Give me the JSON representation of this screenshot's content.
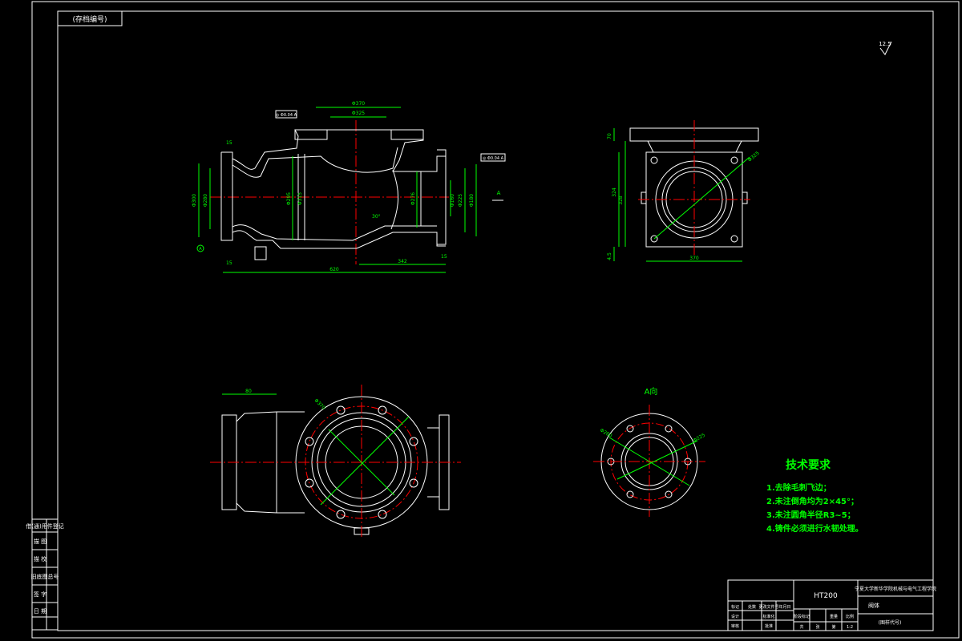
{
  "drawing": {
    "top_left_tag": "(存档编号)",
    "roughness_mark": "12.5",
    "material": "HT200",
    "view_label": "A向",
    "section_label": "A"
  },
  "dimensions": {
    "flange_outer": "Φ370",
    "flange_bolt": "Φ325",
    "left_flange_height": "15",
    "pipe_main": "Φ295",
    "pipe_inner": "Φ315",
    "pipe_side": "Φ276",
    "right_flange_thk": "15",
    "total_length": "620",
    "right_length": "342",
    "bottom_len": "15",
    "left_phi": "Φ300",
    "left_phi2": "Φ280",
    "right_phi": "Φ225",
    "right_phi2": "Φ180",
    "right_phi3": "Φ160",
    "top_height": "70",
    "side_height": "324",
    "side_inner": "328",
    "side_width": "370",
    "side_small": "4.5",
    "side_diag": "Φ325",
    "front_len": "80",
    "front_diag": "Φ370",
    "av_diag1": "Φ260",
    "av_diag2": "Φ225",
    "angle": "30°",
    "tol_box1": "◎ Φ0.04 A",
    "tol_box2": "◎ Φ0.04 A"
  },
  "tech": {
    "title": "技术要求",
    "items": [
      "1.去除毛刺飞边；",
      "2.未注倒角均为2×45°；",
      "3.未注圆角半径R3~5；",
      "4.铸件必须进行水韧处理。"
    ]
  },
  "left_strip": {
    "labels": [
      "借(通)用件登记",
      "描  图",
      "描  校",
      "旧底图总号",
      "签  字",
      "日  期"
    ]
  },
  "title_block": {
    "material_cell": "HT200",
    "school": "宁夏大学新华学院机械与电气工程学院",
    "part_name": "阀体",
    "drawing_no": "(图样代号)",
    "row_labels": [
      "标记",
      "处数",
      "分区",
      "更改文件号",
      "签名",
      "年月日"
    ],
    "role_labels": [
      "设计",
      "审核",
      "工艺"
    ],
    "stage_labels": [
      "阶段标记",
      "重量",
      "比例"
    ],
    "sheet_labels": [
      "共",
      "张",
      "第",
      "张"
    ],
    "scale": "1:2",
    "standardize": "标准化",
    "approve": "批准"
  }
}
